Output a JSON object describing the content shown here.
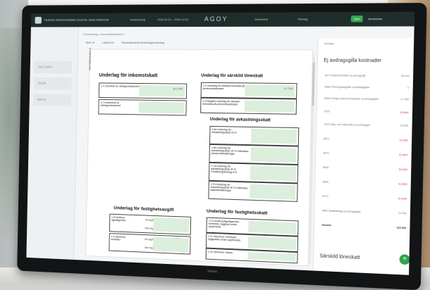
{
  "app": {
    "name": "TAXEDO REDOVISNING DIGITAL DEKLARATION",
    "brand": "AGOY",
    "controls": [
      "Redovisning",
      "2022-01-01 – 2022-12-31",
      "Dokument",
      "Företag"
    ],
    "button": "Start",
    "user": "Användare"
  },
  "sidebar": {
    "items": [
      "INK2 Sidor",
      "INK2R",
      "INK2S"
    ]
  },
  "crumbs": "Redovisning • Inkomstdeklaration 2",
  "toolbar": [
    "Skriv ut",
    "Ladda ner",
    "Deklarationens förhandsgranskning"
  ],
  "form": {
    "side_text": "Inkomstdeklaration 2",
    "sections": {
      "inkomstskatt": "Underlag för inkomstskatt",
      "sarskild_loneskatt": "Underlag för särskild löneskatt",
      "avkastningsskatt": "Underlag för avkastningsskatt",
      "fastighetsavgift": "Underlag för fastighetsavgift",
      "fastighetsskatt": "Underlag för fastighetsskatt"
    },
    "inkomst_rows": [
      {
        "label": "1.1 Överskott av näringsverksamhet",
        "value": "321 900"
      },
      {
        "label": "1.2 Underskott av näringsverksamhet",
        "value": ""
      }
    ],
    "loneskatt_rows": [
      {
        "label": "1.4 Underlag för särskild löneskatt på pensionskostnader",
        "value": "12 700"
      },
      {
        "label": "1.5 Negativt underlag för särskild löneskatt på pensionskostnader",
        "value": ""
      }
    ],
    "avkastning_rows": [
      {
        "label": "1.6a Underlag för avkastningsskatt 15 %"
      },
      {
        "label": "1.6b Underlag för avkastningsskatt 15 % Utländska pensionsförsäkringar"
      },
      {
        "label": "1.7a Underlag för avkastningsskatt 30 % Försäkringsföretag m.fl."
      },
      {
        "label": "1.7b Underlag för avkastningsskatt 30 % Utländska kapitalförsäkringar"
      }
    ],
    "fastighetsavgift_rows": [
      {
        "label": "1.8 Småhus/ ägarlägenhet",
        "sub": [
          "hel avgift",
          "halv avgift"
        ]
      },
      {
        "label": "1.9 Hyreshus, bostäder",
        "sub": [
          "hel avgift",
          "halv avgift"
        ]
      }
    ],
    "fastighetsskatt_rows": [
      {
        "label": "1.10 Småhus/ägarlägenhet: tomtmark, byggnad under uppförande"
      },
      {
        "label": "1.11 Hyreshus: tomtmark, byggnader under uppförande"
      },
      {
        "label": "1.12 Hyreshus: lokaler"
      }
    ]
  },
  "panel": {
    "top_label": "Särskild",
    "title": "Ej avdragsgilla kostnader",
    "rows": [
      {
        "label": "6072 Representation ej avdragsgill",
        "value": "38 010",
        "neg": false
      },
      {
        "label": "6982 Föreningsavgifter ej avdragsgilla",
        "value": "0",
        "neg": false
      },
      {
        "label": "6992 Övriga externa kostnader ej avdragsgilla",
        "value": "17 000",
        "neg": false
      },
      {
        "label": "7622",
        "value": "Ej ifylld",
        "neg": true
      },
      {
        "label": "7623 Sjuk- och hälsovård ej avdragsgill",
        "value": "15 000",
        "neg": false
      },
      {
        "label": "8423",
        "value": "Ej ifylld",
        "neg": true
      },
      {
        "label": "8472",
        "value": "Ej ifylld",
        "neg": true
      },
      {
        "label": "8490",
        "value": "Ej ifylld",
        "neg": true
      },
      {
        "label": "8500",
        "value": "Ej ifylld",
        "neg": true
      },
      {
        "label": "8710",
        "value": "Ej ifylld",
        "neg": true
      },
      {
        "label": "8452 Skattetillägg ej avdragsgilla",
        "value": "12 000",
        "neg": false
      },
      {
        "label": "Summa",
        "value": "115 000",
        "neg": false
      }
    ],
    "bottom_title": "Särskild löneskatt",
    "fab": "+"
  }
}
